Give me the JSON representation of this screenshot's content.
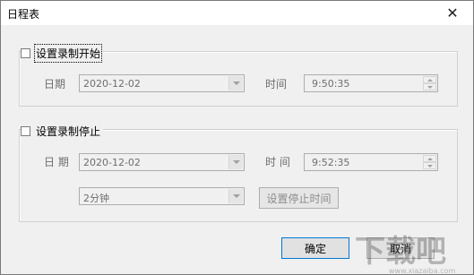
{
  "window": {
    "title": "日程表",
    "close_glyph": "✕"
  },
  "start": {
    "checkbox_label": "设置录制开始",
    "date_label": "日期",
    "date_value": "2020-12-02",
    "time_label": "时间",
    "time_value": "9:50:35"
  },
  "stop": {
    "checkbox_label": "设置录制停止",
    "date_label": "日 期",
    "date_value": "2020-12-02",
    "time_label": "时 间",
    "time_value": "9:52:35",
    "duration_value": "2分钟",
    "set_stop_time_button": "设置停止时间"
  },
  "buttons": {
    "ok": "确定",
    "cancel": "取消"
  },
  "watermark": {
    "text": "下载吧",
    "url": "www.xiazaiba.com"
  },
  "icons": [
    "close-icon",
    "checkbox-icon",
    "dropdown-arrow-icon",
    "spin-up-icon",
    "spin-down-icon"
  ]
}
